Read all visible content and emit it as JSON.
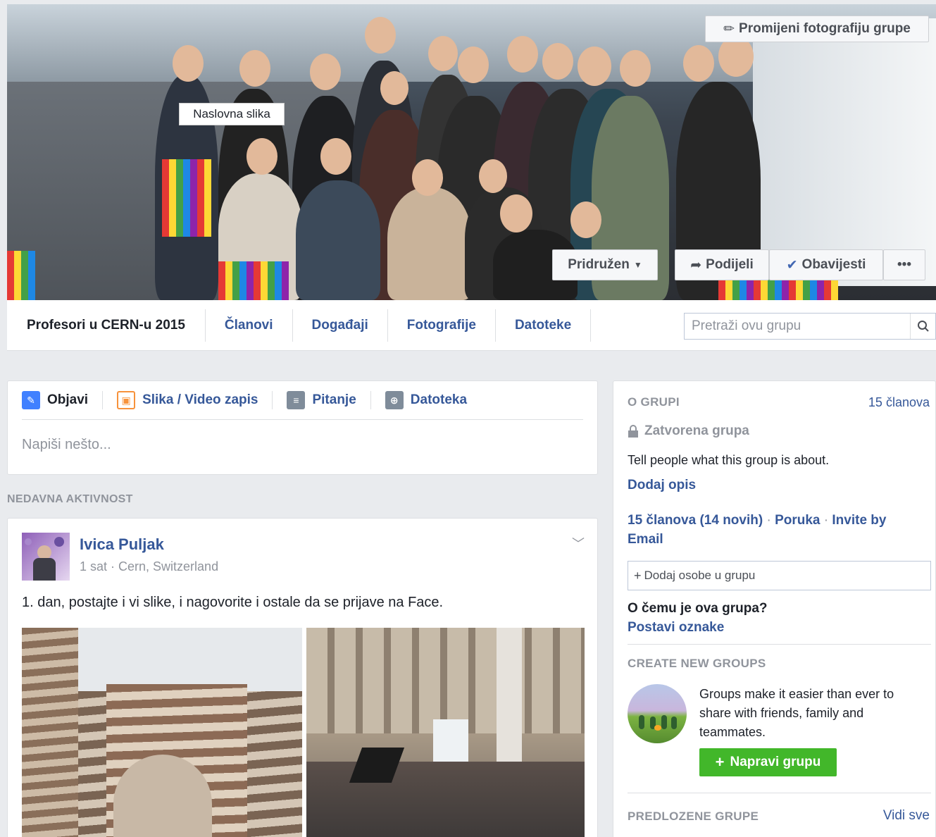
{
  "cover": {
    "change_photo_label": "Promijeni fotografiju grupe",
    "cover_tooltip": "Naslovna slika",
    "joined_label": "Pridružen",
    "share_label": "Podijeli",
    "notify_label": "Obavijesti",
    "more_label": "•••"
  },
  "nav": {
    "group_name": "Profesori u CERN-u 2015",
    "tabs": [
      "Članovi",
      "Događaji",
      "Fotografije",
      "Datoteke"
    ],
    "search_placeholder": "Pretraži ovu grupu"
  },
  "composer": {
    "tabs": [
      "Objavi",
      "Slika / Video zapis",
      "Pitanje",
      "Datoteka"
    ],
    "placeholder": "Napiši nešto..."
  },
  "recent_activity_header": "NEDAVNA AKTIVNOST",
  "post": {
    "author": "Ivica Puljak",
    "meta": "1 sat · Cern, Switzerland",
    "text": "1. dan, postajte i vi slike, i nagovorite i ostale da se prijave na Face."
  },
  "sidebar": {
    "about_header": "O GRUPI",
    "member_count": "15 članova",
    "privacy": "Zatvorena grupa",
    "description_prompt": "Tell people what this group is about.",
    "add_description": "Dodaj opis",
    "members_summary": "15 članova",
    "new_members": "(14 novih)",
    "sep1": "·",
    "message_link": "Poruka",
    "sep2": "·",
    "invite_email": "Invite by Email",
    "add_people_placeholder": "Dodaj osobe u grupu",
    "what_about": "O čemu je ova grupa?",
    "set_tags": "Postavi oznake",
    "create_groups_header": "CREATE NEW GROUPS",
    "create_groups_text": "Groups make it easier than ever to share with friends, family and teammates.",
    "create_group_button": "Napravi grupu",
    "suggested_header": "PREDLOZENE GRUPE",
    "see_all": "Vidi sve"
  },
  "colors": {
    "link_blue": "#365899",
    "green": "#42b72a",
    "grey_text": "#90949c"
  }
}
